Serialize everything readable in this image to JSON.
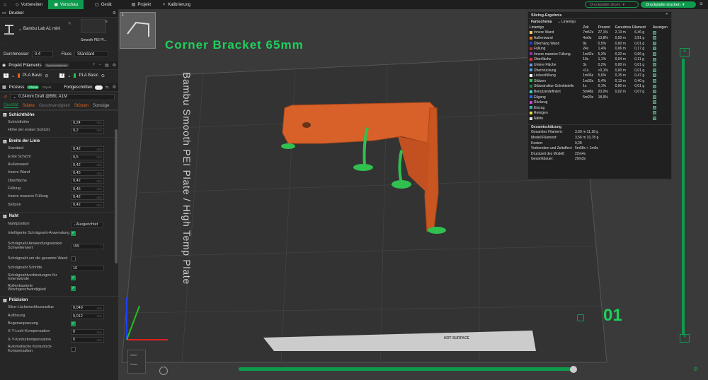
{
  "topbar": {
    "tabs": [
      {
        "label": "Vorbereiten"
      },
      {
        "label": "Vorschau"
      },
      {
        "label": "Gerät"
      },
      {
        "label": "Projekt"
      },
      {
        "label": "Kalibrierung"
      }
    ],
    "slice_button": "Druckplatte slicen",
    "print_button": "Druckplatte drucken"
  },
  "printer": {
    "header": "Drucker",
    "name": "Bambu Lab A1 mini",
    "plate_type": "Smooth PEI Pl...",
    "nozzle_diameter_label": "Durchmesser",
    "nozzle_diameter": "0.4",
    "flow_label": "Fluss",
    "flow": "Standard"
  },
  "filaments": {
    "header": "Projekt Filaments",
    "sync_badge": "Synchronisieren",
    "items": [
      {
        "num": "1",
        "name": "PLA Basic"
      },
      {
        "num": "2",
        "name": "PLA Basic"
      }
    ]
  },
  "process": {
    "header": "Prozess",
    "global": "Global",
    "object": "Objekt",
    "advanced": "Fortgeschritten",
    "preset": "0.24mm Draft @BBL A1M",
    "tabs": [
      {
        "label": "Qualität"
      },
      {
        "label": "Stärke"
      },
      {
        "label": "Geschwindigkeit"
      },
      {
        "label": "Stützen"
      },
      {
        "label": "Sonstige"
      }
    ]
  },
  "sections": {
    "layer_height": {
      "title": "Schichthöhe",
      "rows": [
        {
          "label": "Schichthöhe",
          "value": "0,24",
          "unit": "mm"
        },
        {
          "label": "Höhe der ersten Schicht",
          "value": "0,2",
          "unit": "mm"
        }
      ]
    },
    "line_width": {
      "title": "Breite der Linie",
      "rows": [
        {
          "label": "Standard",
          "value": "0,42",
          "unit": "mm"
        },
        {
          "label": "Erste Schicht",
          "value": "0,5",
          "unit": "mm"
        },
        {
          "label": "Außenwand",
          "value": "0,42",
          "unit": "mm"
        },
        {
          "label": "Innere Wand",
          "value": "0,45",
          "unit": "mm"
        },
        {
          "label": "Oberfläche",
          "value": "0,42",
          "unit": "mm"
        },
        {
          "label": "Füllung",
          "value": "0,45",
          "unit": "mm"
        },
        {
          "label": "Innere massive Füllung",
          "value": "0,42",
          "unit": "mm"
        },
        {
          "label": "Stützen",
          "value": "0,42",
          "unit": "mm"
        }
      ]
    },
    "seam": {
      "title": "Naht",
      "position_label": "Nahtposition",
      "position_value": "Ausgerichtet",
      "smart": "Intelligente Schrägnaht-Anwendung",
      "angle_label": "Schrägnaht Anwendungswinkel Schwellenwert",
      "angle_value": "155",
      "angle_unit": "°",
      "whole_wall": "Schrägnaht um die gesamte Wand",
      "steps_label": "Schrägnaht Schritte",
      "steps_value": "10",
      "inner": "Schrägnahtverbindungen für Innenwände",
      "roller": "Rollenbasierte Wischgeschwindigkeit"
    },
    "precision": {
      "title": "Präzision",
      "rows": [
        {
          "label": "Slice-Lückenschlussradius",
          "value": "0,049",
          "unit": "mm"
        },
        {
          "label": "Auflösung",
          "value": "0,012",
          "unit": "mm"
        }
      ],
      "arc_label": "Bogenanpassung",
      "xy_hole_label": "X-Y-Loch-Kompensation",
      "xy_hole_value": "0",
      "xy_contour_label": "X-Y-Konturkompensation",
      "xy_contour_value": "0",
      "auto_label": "Automatische Konturloch-Kompensation",
      "unit": "mm"
    }
  },
  "viewport": {
    "title": "Corner Bracket 65mm",
    "plate_label": "Bambu Smooth PEI Plate / High Temp Plate",
    "plate_number": "01",
    "thumb_number": "1",
    "hot_label": "HOT SURFACE"
  },
  "stats": {
    "title": "Slicing-Ergebnis",
    "scheme_label": "Farbschema",
    "scheme_value": "Linientyp",
    "headers": [
      "Linientyp",
      "Zeit",
      "Prozent",
      "Genutztes Filament",
      "",
      "Anzeigen"
    ],
    "rows": [
      {
        "name": "Innere Wand",
        "color": "#f5d060",
        "time": "7m52s",
        "pct": "27,1%",
        "len": "2,13 m",
        "weight": "6,46 g"
      },
      {
        "name": "Außenwand",
        "color": "#f07a20",
        "time": "4m0s",
        "pct": "13,8%",
        "len": "0,93 m",
        "weight": "2,81 g"
      },
      {
        "name": "Überhang Wand",
        "color": "#2040d0",
        "time": "8s",
        "pct": "0,5%",
        "len": "0,00 m",
        "weight": "0,01 g"
      },
      {
        "name": "Füllung",
        "color": "#b03030",
        "time": "24s",
        "pct": "1,4%",
        "len": "0,06 m",
        "weight": "0,17 g"
      },
      {
        "name": "Innere massive Füllung",
        "color": "#9030b0",
        "time": "1m32s",
        "pct": "5,3%",
        "len": "0,22 m",
        "weight": "0,66 g"
      },
      {
        "name": "Oberfläche",
        "color": "#e03030",
        "time": "19s",
        "pct": "1,1%",
        "len": "0,04 m",
        "weight": "0,11 g"
      },
      {
        "name": "Untere Fläche",
        "color": "#7090e0",
        "time": "3s",
        "pct": "0,2%",
        "len": "0,00 m",
        "weight": "0,01 g"
      },
      {
        "name": "Überbrückung",
        "color": "#50a0e0",
        "time": "<1s",
        "pct": "<0,1%",
        "len": "0,00 m",
        "weight": "0,01 g"
      },
      {
        "name": "Lückenfüllung",
        "color": "#ffffff",
        "time": "1m36s",
        "pct": "5,6%",
        "len": "0,15 m",
        "weight": "0,47 g"
      },
      {
        "name": "Stützen",
        "color": "#30c050",
        "time": "1m33s",
        "pct": "5,4%",
        "len": "0,13 m",
        "weight": "0,40 g"
      },
      {
        "name": "Stützstruktur-Schnittstelle",
        "color": "#208040",
        "time": "1s",
        "pct": "0,1%",
        "len": "0,00 m",
        "weight": "0,01 g"
      },
      {
        "name": "Benutzerdefiniert",
        "color": "#40d0c0",
        "time": "5m48s",
        "pct": "20,0%",
        "len": "0,02 m",
        "weight": "0,07 g"
      },
      {
        "name": "Eilgang",
        "color": "#3060ff",
        "time": "5m29s",
        "pct": "18,9%",
        "len": "",
        "weight": ""
      },
      {
        "name": "Rückzug",
        "color": "#d040d0",
        "time": "",
        "pct": "",
        "len": "",
        "weight": ""
      },
      {
        "name": "Einzug",
        "color": "#40b0b0",
        "time": "",
        "pct": "",
        "len": "",
        "weight": ""
      },
      {
        "name": "Reinigen",
        "color": "#e0e040",
        "time": "",
        "pct": "",
        "len": "",
        "weight": ""
      },
      {
        "name": "Nähte",
        "color": "#e0e0e0",
        "time": "",
        "pct": "",
        "len": "",
        "weight": ""
      }
    ],
    "summary_title": "Gesamtschätzung",
    "summary": [
      {
        "k": "Gesamtes Filament:",
        "v": "3,69 m    11,18 g"
      },
      {
        "k": "Modell Filament:",
        "v": "3,56 m    10,78 g"
      },
      {
        "k": "Kosten:",
        "v": "0,28"
      },
      {
        "k": "Vorbereiten und Zeitaffect:",
        "v": "5m58s + 1m0s"
      },
      {
        "k": "Druckzeit des Modell:",
        "v": "22m4s"
      },
      {
        "k": "Gesamtdauer:",
        "v": "29m3s"
      }
    ]
  },
  "navcube": {
    "top": "Oben",
    "front": "Vorne"
  }
}
